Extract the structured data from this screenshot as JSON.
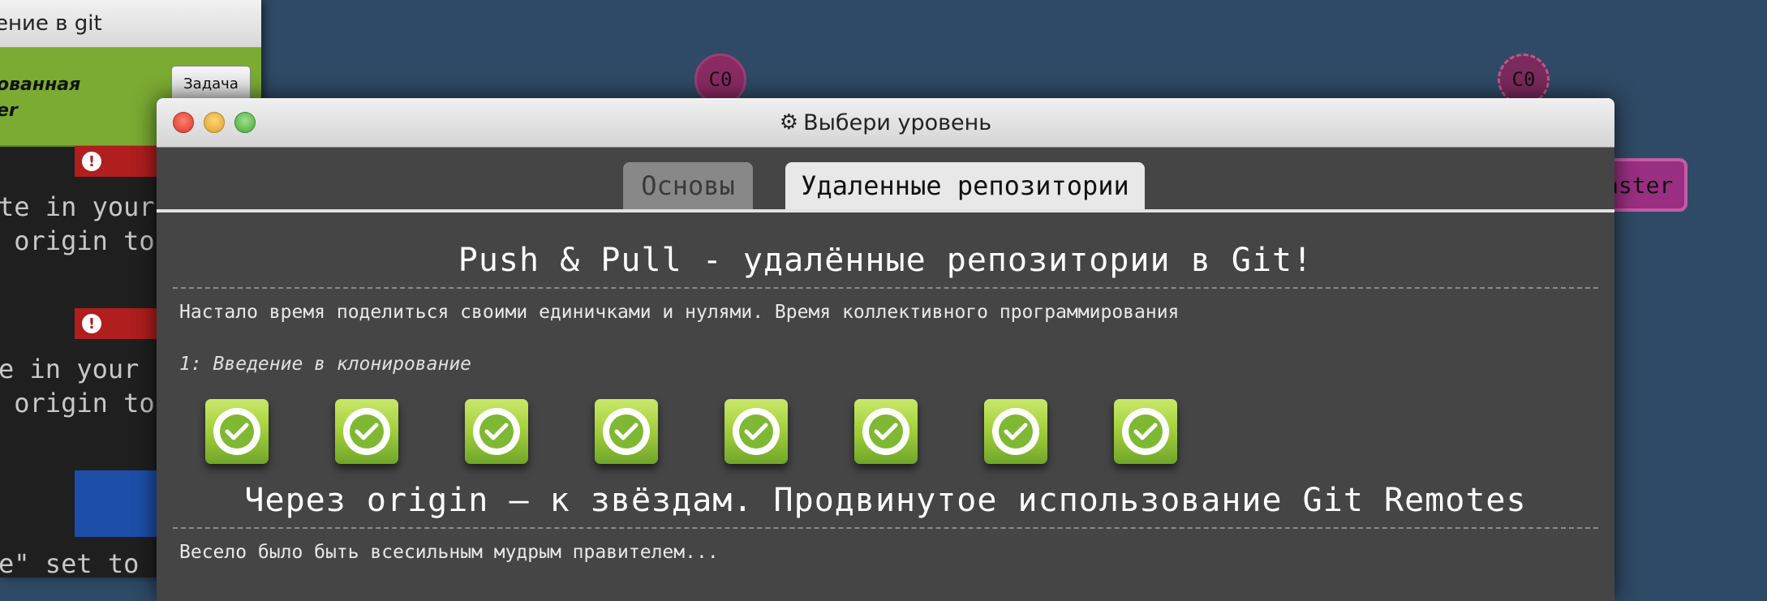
{
  "background": {
    "commits": [
      "C0",
      "C0"
    ],
    "branch_label": "aster",
    "left_panel": {
      "title": "ение в git",
      "goal_text_line1": "ованная",
      "goal_text_line2": "er",
      "task_button": "Задача",
      "error_icon": "!",
      "terminal_lines": [
        "te in your",
        " origin to",
        "e in your",
        " origin to",
        "e\" set to"
      ]
    }
  },
  "dialog": {
    "title": "Выбери уровень",
    "title_icon": "gear-icon",
    "tabs": [
      "Основы",
      "Удаленные репозитории"
    ],
    "active_tab": "Удаленные репозитории",
    "sections": [
      {
        "title": "Push & Pull - удалённые репозитории в Git!",
        "description": "Настало время поделиться своими единичками и нулями. Время коллективного программирования",
        "current_level": "1: Введение в клонирование",
        "levels_completed": 8
      },
      {
        "title": "Через origin – к звёздам. Продвинутое использование Git Remotes",
        "description": "Весело было быть всесильным мудрым правителем..."
      }
    ]
  },
  "colors": {
    "accent_green": "#7fb832",
    "background": "#2f4a66",
    "dialog_bg": "#454545"
  }
}
